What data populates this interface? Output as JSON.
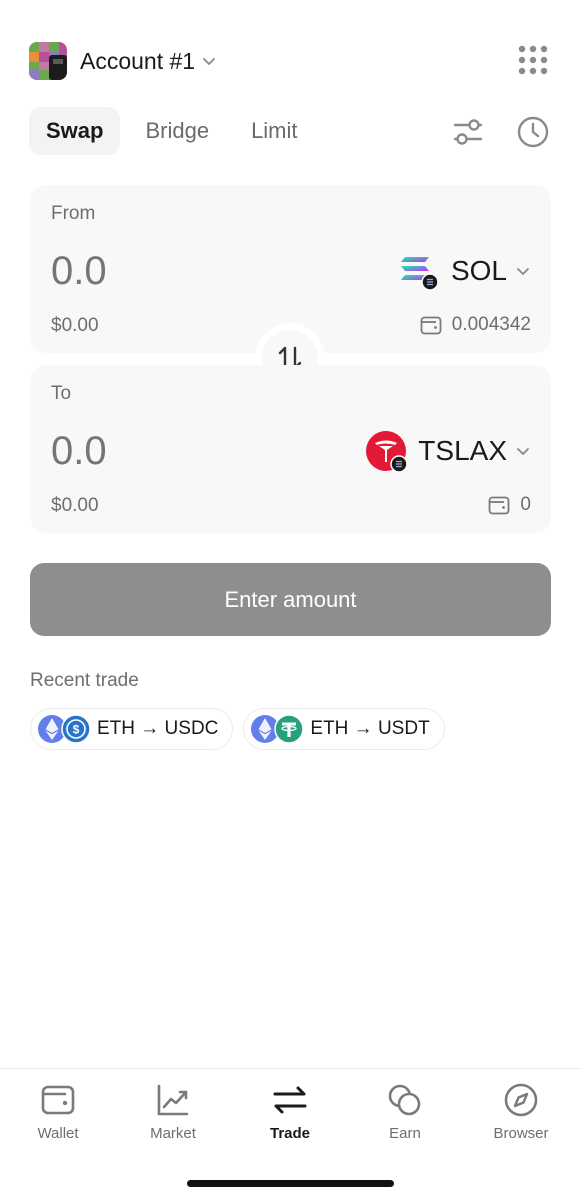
{
  "account": {
    "name": "Account #1"
  },
  "tabs": [
    {
      "label": "Swap",
      "active": true
    },
    {
      "label": "Bridge",
      "active": false
    },
    {
      "label": "Limit",
      "active": false
    }
  ],
  "from": {
    "label": "From",
    "amount": "0.0",
    "fiat": "$0.00",
    "token": "SOL",
    "token_icon": "solana-icon",
    "balance": "0.004342"
  },
  "to": {
    "label": "To",
    "amount": "0.0",
    "fiat": "$0.00",
    "token": "TSLAX",
    "token_icon": "tesla-icon",
    "balance": "0"
  },
  "cta": {
    "label": "Enter amount"
  },
  "recent": {
    "title": "Recent trade",
    "items": [
      {
        "label": "ETH → USDC",
        "from_icon": "ethereum-icon",
        "to_icon": "usdc-icon"
      },
      {
        "label": "ETH → USDT",
        "from_icon": "ethereum-icon",
        "to_icon": "usdt-icon"
      }
    ]
  },
  "nav": [
    {
      "label": "Wallet",
      "icon": "wallet-icon",
      "active": false
    },
    {
      "label": "Market",
      "icon": "chart-icon",
      "active": false
    },
    {
      "label": "Trade",
      "icon": "swap-arrows-icon",
      "active": true
    },
    {
      "label": "Earn",
      "icon": "coins-icon",
      "active": false
    },
    {
      "label": "Browser",
      "icon": "compass-icon",
      "active": false
    }
  ],
  "colors": {
    "cta_disabled": "#8e8e8e",
    "card_bg": "#f8f8f8",
    "tesla_red": "#e31937",
    "usdc_blue": "#2775ca",
    "usdt_green": "#26a17b",
    "eth_purple": "#627eea"
  }
}
